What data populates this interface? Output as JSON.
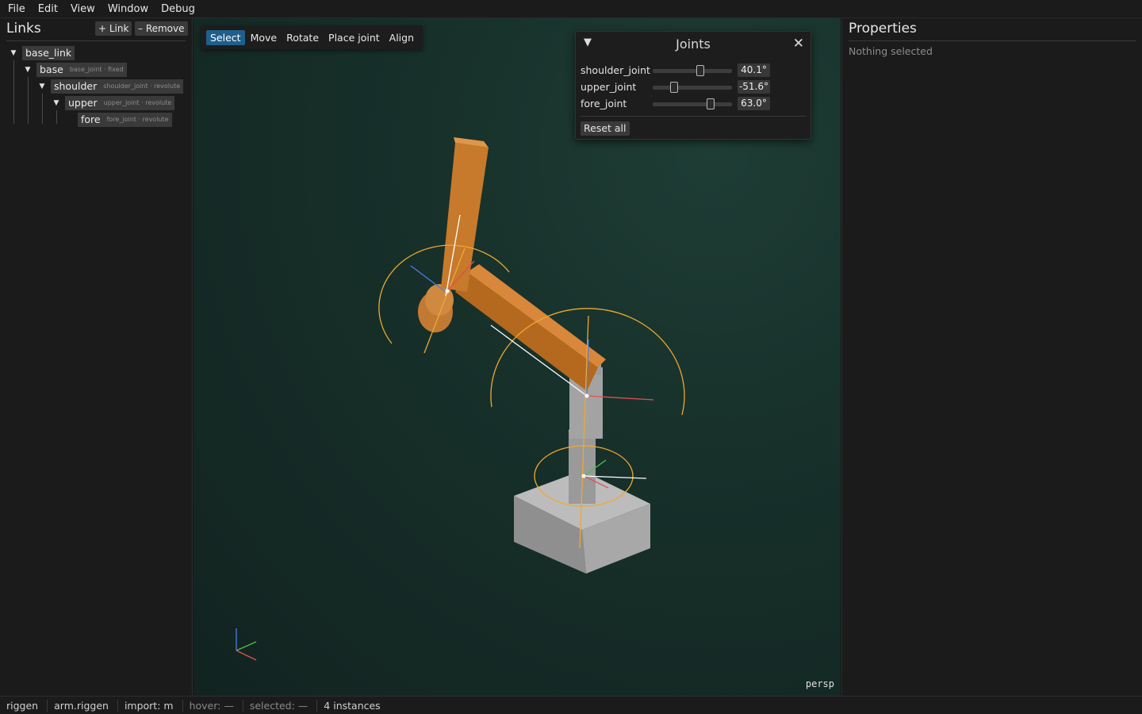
{
  "menubar": {
    "items": [
      "File",
      "Edit",
      "View",
      "Window",
      "Debug"
    ]
  },
  "links_panel": {
    "title": "Links",
    "add_label": "+ Link",
    "remove_label": "– Remove",
    "tree": [
      {
        "name": "base_link",
        "joint": ""
      },
      {
        "name": "base",
        "joint": "base_joint · fixed"
      },
      {
        "name": "shoulder",
        "joint": "shoulder_joint · revolute"
      },
      {
        "name": "upper",
        "joint": "upper_joint · revolute"
      },
      {
        "name": "fore",
        "joint": "fore_joint · revolute"
      }
    ]
  },
  "toolbar": {
    "tools": [
      "Select",
      "Move",
      "Rotate",
      "Place joint",
      "Align"
    ],
    "active": "Select"
  },
  "joints_window": {
    "title": "Joints",
    "joints": [
      {
        "name": "shoulder_joint",
        "value": "40.1°",
        "slider_fraction": 0.6
      },
      {
        "name": "upper_joint",
        "value": "-51.6°",
        "slider_fraction": 0.27
      },
      {
        "name": "fore_joint",
        "value": "63.0°",
        "slider_fraction": 0.73
      }
    ],
    "reset_label": "Reset all"
  },
  "viewport": {
    "projection_label": "persp"
  },
  "properties_panel": {
    "title": "Properties",
    "empty_text": "Nothing selected"
  },
  "statusbar": {
    "app": "riggen",
    "file": "arm.riggen",
    "import": "import: m",
    "hover": "hover: —",
    "selected": "selected: —",
    "instances": "4 instances"
  },
  "colors": {
    "accent": "#1f5f8b",
    "link_orange": "#c77a2b",
    "gizmo_ring": "#f0a830",
    "base_grey": "#b4b4b4"
  }
}
